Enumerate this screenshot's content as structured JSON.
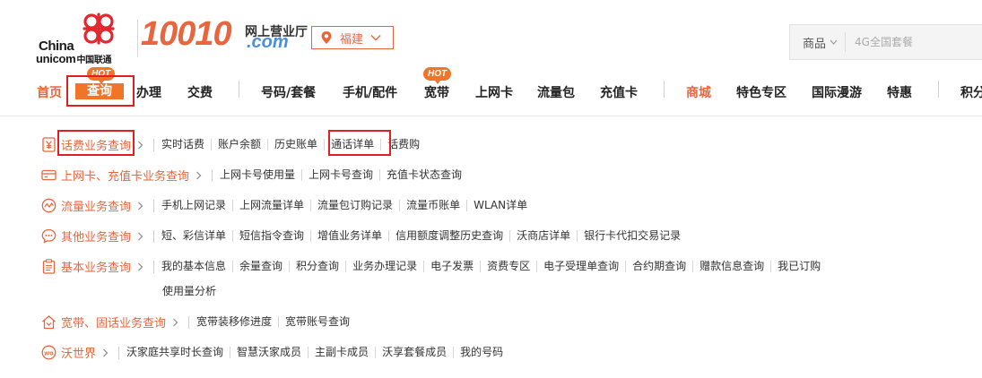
{
  "header": {
    "logo": {
      "line1": "China",
      "line2": "unicom",
      "line2_cn": "中国联通"
    },
    "brand_number": "10010",
    "brand_cn": "网上营业厅",
    "brand_domain": ".com",
    "city": "福建",
    "search": {
      "category": "商品",
      "placeholder": "4G全国套餐"
    }
  },
  "nav": {
    "items": [
      {
        "label": "首页"
      },
      {
        "label": "查询",
        "badge": "HOT"
      },
      {
        "label": "办理"
      },
      {
        "label": "交费"
      },
      {
        "label": "号码/套餐"
      },
      {
        "label": "手机/配件"
      },
      {
        "label": "宽带",
        "badge": "HOT"
      },
      {
        "label": "上网卡"
      },
      {
        "label": "流量包"
      },
      {
        "label": "充值卡"
      },
      {
        "label": "商城"
      },
      {
        "label": "特色专区"
      },
      {
        "label": "国际漫游"
      },
      {
        "label": "特惠"
      },
      {
        "label": "积分"
      }
    ]
  },
  "menu": {
    "rows": [
      {
        "title": "话费业务查询",
        "links": [
          "实时话费",
          "账户余额",
          "历史账单",
          "通话详单",
          "话费购"
        ]
      },
      {
        "title": "上网卡、充值卡业务查询",
        "links": [
          "上网卡号使用量",
          "上网卡号查询",
          "充值卡状态查询"
        ]
      },
      {
        "title": "流量业务查询",
        "links": [
          "手机上网记录",
          "上网流量详单",
          "流量包订购记录",
          "流量币账单",
          "WLAN详单"
        ]
      },
      {
        "title": "其他业务查询",
        "links": [
          "短、彩信详单",
          "短信指令查询",
          "增值业务详单",
          "信用额度调整历史查询",
          "沃商店详单",
          "银行卡代扣交易记录"
        ]
      },
      {
        "title": "基本业务查询",
        "links": [
          "我的基本信息",
          "余量查询",
          "积分查询",
          "业务办理记录",
          "电子发票",
          "资费专区",
          "电子受理单查询",
          "合约期查询",
          "赠款信息查询",
          "我已订购"
        ],
        "links_line2": "使用量分析"
      },
      {
        "title": "宽带、固话业务查询",
        "links": [
          "宽带装移修进度",
          "宽带账号查询"
        ]
      },
      {
        "title": "沃世界",
        "links": [
          "沃家庭共享时长查询",
          "智慧沃家成员",
          "主副卡成员",
          "沃享套餐成员",
          "我的号码"
        ]
      }
    ]
  },
  "colors": {
    "accent": "#e8663d",
    "highlight_box": "#e02020",
    "brand_blue": "#4b8fd8"
  }
}
